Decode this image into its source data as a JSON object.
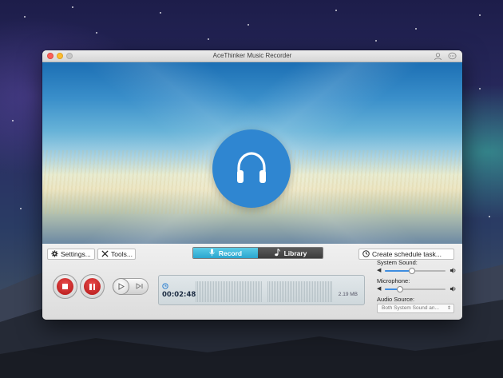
{
  "window": {
    "title": "AceThinker Music Recorder"
  },
  "toolbar": {
    "settings_label": "Settings...",
    "tools_label": "Tools...",
    "record_tab": "Record",
    "library_tab": "Library",
    "schedule_label": "Create schedule task..."
  },
  "recorder": {
    "elapsed_time": "00:02:48",
    "file_size": "2.19 MB"
  },
  "audio": {
    "system_sound_label": "System Sound:",
    "system_sound_level": 0.45,
    "microphone_label": "Microphone:",
    "microphone_level": 0.25,
    "audio_source_label": "Audio Source:",
    "audio_source_value": "Both System Sound an..."
  },
  "colors": {
    "accent": "#2f86d1",
    "record_red": "#d42a2a",
    "record_tab": "#36b3d9"
  },
  "icons": {
    "hero": "headphones-icon",
    "settings": "gear-icon",
    "tools": "wrench-icon",
    "record": "microphone-icon",
    "library": "music-note-icon",
    "schedule": "clock-icon"
  }
}
